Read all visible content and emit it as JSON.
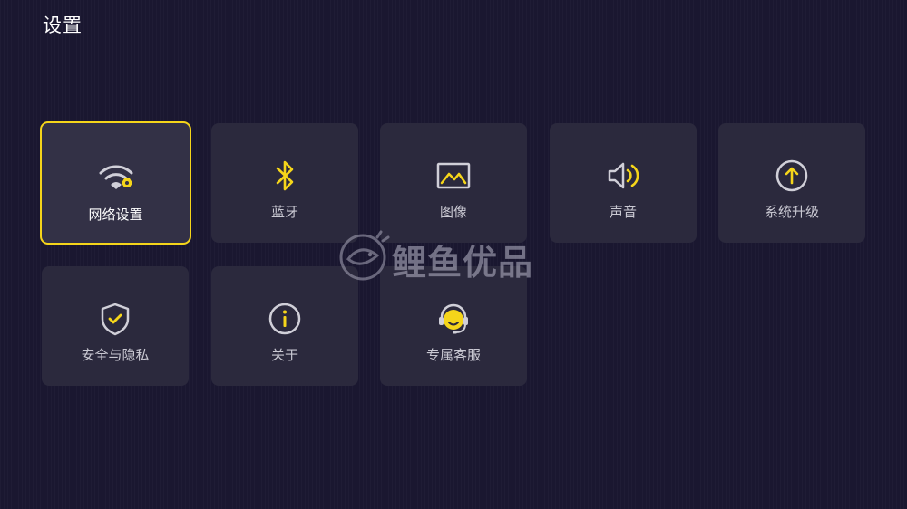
{
  "header": {
    "title": "设置"
  },
  "tiles": [
    {
      "label": "网络设置",
      "icon": "wifi-settings-icon",
      "focused": true
    },
    {
      "label": "蓝牙",
      "icon": "bluetooth-icon",
      "focused": false
    },
    {
      "label": "图像",
      "icon": "image-icon",
      "focused": false
    },
    {
      "label": "声音",
      "icon": "speaker-icon",
      "focused": false
    },
    {
      "label": "系统升级",
      "icon": "upgrade-arrow-icon",
      "focused": false
    },
    {
      "label": "安全与隐私",
      "icon": "shield-check-icon",
      "focused": false
    },
    {
      "label": "关于",
      "icon": "info-icon",
      "focused": false
    },
    {
      "label": "专属客服",
      "icon": "headset-icon",
      "focused": false
    }
  ],
  "watermark": {
    "text": "鲤鱼优品",
    "icon": "fish-logo-icon"
  },
  "colors": {
    "background": "#1a1730",
    "tile": "#2b293d",
    "tile_focused": "#333146",
    "accent": "#f5d51a",
    "icon_outline": "#d0cfd8",
    "label": "#c9c8d2",
    "label_focused": "#ffffff"
  }
}
